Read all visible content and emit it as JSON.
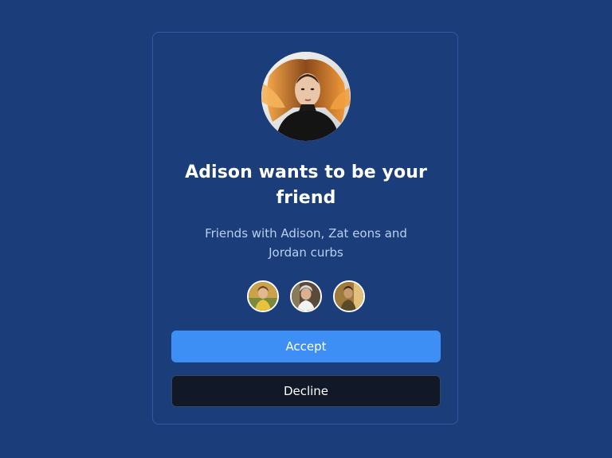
{
  "request": {
    "title": "Adison wants to be your friend",
    "subtitle": "Friends with Adison, Zat eons and Jordan curbs",
    "accept_label": "Accept",
    "decline_label": "Decline"
  },
  "colors": {
    "background": "#1b3e7a",
    "accent": "#3d8ef5",
    "decline_bg": "#111827",
    "subtitle": "#b9cff0"
  },
  "icons": [
    "profile-photo",
    "mutual-friend-avatar"
  ]
}
